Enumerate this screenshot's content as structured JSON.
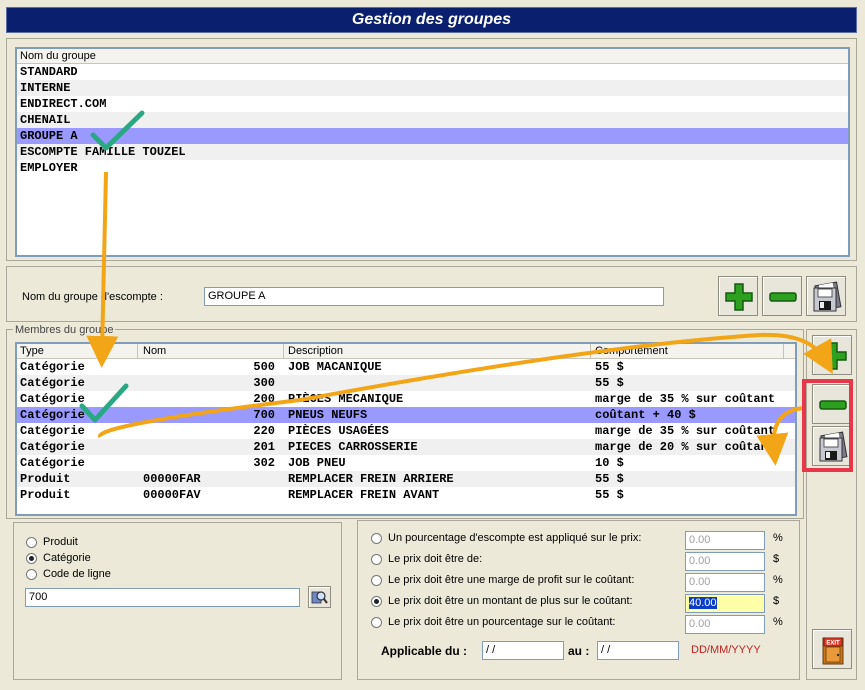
{
  "window": {
    "title": "Gestion des groupes"
  },
  "groups": {
    "column_header": "Nom du groupe",
    "items": [
      "STANDARD",
      "INTERNE",
      "ENDIRECT.COM",
      "CHENAIL",
      "GROUPE A",
      "ESCOMPTE FAMILLE TOUZEL",
      "EMPLOYER"
    ],
    "selected_index": 4
  },
  "group_name": {
    "label": "Nom du groupe d'escompte :",
    "value": "GROUPE A"
  },
  "members": {
    "section_label": "Membres du groupe",
    "headers": {
      "type": "Type",
      "nom": "Nom",
      "description": "Description",
      "comportement": "Comportement"
    },
    "rows": [
      {
        "type": "Catégorie",
        "nom": "500",
        "description": "JOB MACANIQUE",
        "comportement": "55 $"
      },
      {
        "type": "Catégorie",
        "nom": "300",
        "description": "",
        "comportement": "55 $"
      },
      {
        "type": "Catégorie",
        "nom": "200",
        "description": "PIÈCES MÉCANIQUE",
        "comportement": "marge de 35 % sur coûtant"
      },
      {
        "type": "Catégorie",
        "nom": "700",
        "description": "PNEUS NEUFS",
        "comportement": "coûtant + 40 $"
      },
      {
        "type": "Catégorie",
        "nom": "220",
        "description": "PIÈCES USAGÉES",
        "comportement": "marge de 35 % sur coûtant"
      },
      {
        "type": "Catégorie",
        "nom": "201",
        "description": "PIECES CARROSSERIE",
        "comportement": "marge de 20 % sur coûtant"
      },
      {
        "type": "Catégorie",
        "nom": "302",
        "description": "JOB PNEU",
        "comportement": "10 $"
      },
      {
        "type": "Produit",
        "nom": "00000FAR",
        "description": "REMPLACER FREIN ARRIERE",
        "comportement": "55 $"
      },
      {
        "type": "Produit",
        "nom": "00000FAV",
        "description": "REMPLACER FREIN AVANT",
        "comportement": "55 $"
      }
    ],
    "selected_index": 3
  },
  "type_selector": {
    "options": [
      "Produit",
      "Catégorie",
      "Code de ligne"
    ],
    "selected_index": 1,
    "code_value": "700"
  },
  "pricing": {
    "options": [
      {
        "label": "Un pourcentage d'escompte est appliqué sur le prix:",
        "value": "0.00",
        "unit": "%"
      },
      {
        "label": "Le prix doit être de:",
        "value": "0.00",
        "unit": "$"
      },
      {
        "label": "Le prix doit être une marge de profit sur le coûtant:",
        "value": "0.00",
        "unit": "%"
      },
      {
        "label": "Le prix doit être un montant de plus sur le coûtant:",
        "value": "40.00",
        "unit": "$"
      },
      {
        "label": "Le prix doit être un pourcentage sur le coûtant:",
        "value": "0.00",
        "unit": "%"
      }
    ],
    "selected_index": 3,
    "applicable_label": "Applicable du :",
    "from_value": " / /",
    "to_label": "au :",
    "to_value": " / /",
    "date_format": "DD/MM/YYYY"
  },
  "buttons": {
    "exit_label": "EXIT"
  },
  "colors": {
    "title_bg": "#0a1f6e",
    "selection": "#9999ff",
    "arrow": "#f2a516",
    "check": "#2aa884",
    "highlight_box": "#e8374a",
    "add_green": "#2ea01f",
    "date_hint": "#c02020"
  }
}
